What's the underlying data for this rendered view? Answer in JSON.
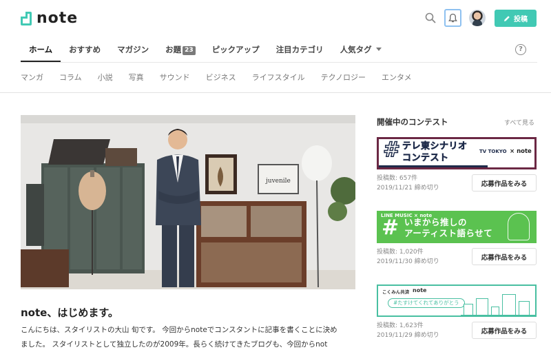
{
  "header": {
    "logo_text": "note",
    "post_label": "投稿",
    "accent_color": "#41c9b4"
  },
  "tabs": [
    {
      "label": "ホーム"
    },
    {
      "label": "おすすめ"
    },
    {
      "label": "マガジン"
    },
    {
      "label": "お題",
      "badge": "23"
    },
    {
      "label": "ピックアップ"
    },
    {
      "label": "注目カテゴリ"
    },
    {
      "label": "人気タグ"
    }
  ],
  "categories": [
    "マンガ",
    "コラム",
    "小説",
    "写真",
    "サウンド",
    "ビジネス",
    "ライフスタイル",
    "テクノロジー",
    "エンタメ"
  ],
  "article": {
    "title": "note、はじめます。",
    "body_line1": "こんにちは、スタイリストの大山 旬です。 今回からnoteでコンスタントに記事を書くことに決め",
    "body_line2": "ました。 スタイリストとして独立したのが2009年。長らく続けてきたブログも、今回からnot"
  },
  "sidebar": {
    "title": "開催中のコンテスト",
    "more": "すべて見る",
    "contests": [
      {
        "banner_hash": "#",
        "banner_line1": "テレ東シナリオ",
        "banner_line2": "コンテスト",
        "banner_brand": "TV TOKYO",
        "banner_x": "×",
        "banner_note": "note",
        "posts": "投稿数: 657件",
        "deadline": "2019/11/21 締め切り",
        "button": "応募作品をみる"
      },
      {
        "banner_top": "LINE MUSIC × note",
        "banner_hash": "#",
        "banner_line1": "いまから推しの",
        "banner_line2": "アーティスト語らせて",
        "posts": "投稿数: 1,020件",
        "deadline": "2019/11/30 締め切り",
        "button": "応募作品をみる"
      },
      {
        "banner_top": "こくみん共済",
        "banner_note": "note",
        "banner_pill": "#たすけてくれてありがとう",
        "posts": "投稿数: 1,623件",
        "deadline": "2019/11/29 締め切り",
        "button": "応募作品をみる"
      }
    ]
  },
  "help_glyph": "?"
}
